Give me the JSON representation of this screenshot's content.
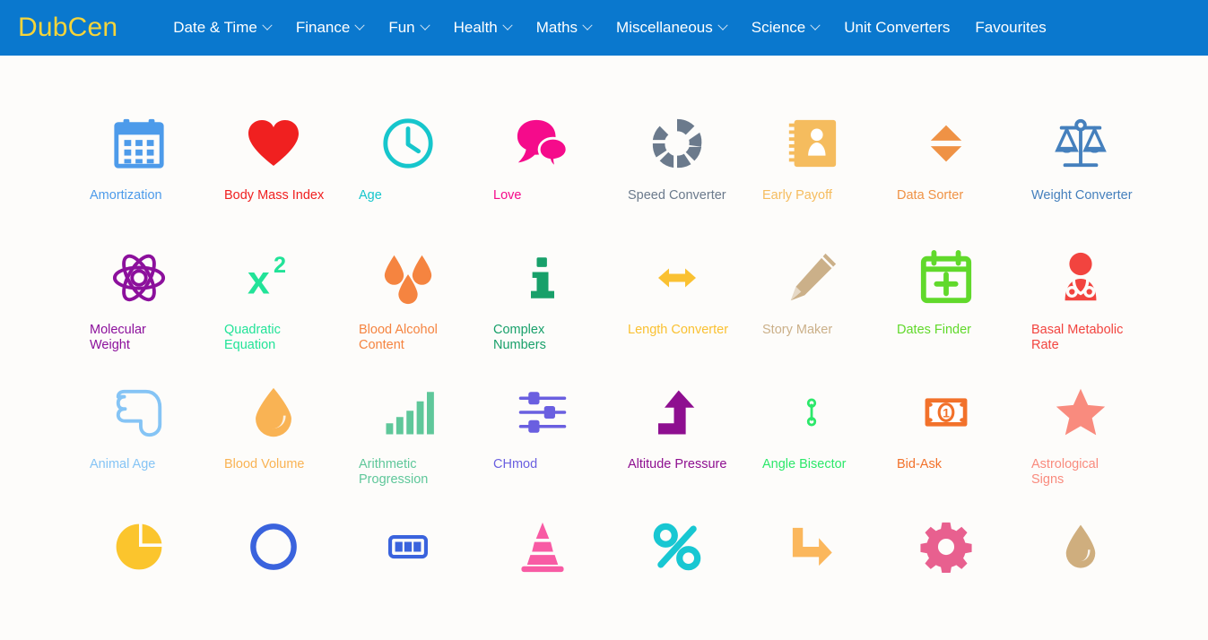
{
  "header": {
    "brand": "DubCen",
    "brand_color": "#f5d43a",
    "bar_color": "#0a78ce",
    "nav": [
      {
        "label": "Date & Time",
        "has_caret": true,
        "icon": "chevron-down-icon"
      },
      {
        "label": "Finance",
        "has_caret": true,
        "icon": "chevron-down-icon"
      },
      {
        "label": "Fun",
        "has_caret": true,
        "icon": "chevron-down-icon"
      },
      {
        "label": "Health",
        "has_caret": true,
        "icon": "chevron-down-icon"
      },
      {
        "label": "Maths",
        "has_caret": true,
        "icon": "chevron-down-icon"
      },
      {
        "label": "Miscellaneous",
        "has_caret": true,
        "icon": "chevron-down-icon"
      },
      {
        "label": "Science",
        "has_caret": true,
        "icon": "chevron-down-icon"
      },
      {
        "label": "Unit Converters",
        "has_caret": false,
        "icon": ""
      },
      {
        "label": "Favourites",
        "has_caret": false,
        "icon": ""
      }
    ]
  },
  "background_color": "#fdfcfa",
  "tiles": [
    {
      "label": "Amortization",
      "icon": "calendar-icon",
      "color": "#4d9bea"
    },
    {
      "label": "Body Mass Index",
      "icon": "heart-icon",
      "color": "#f02020"
    },
    {
      "label": "Age",
      "icon": "clock-icon",
      "color": "#16c6cc"
    },
    {
      "label": "Love",
      "icon": "speech-bubbles-icon",
      "color": "#f50b8b"
    },
    {
      "label": "Speed Converter",
      "icon": "speedometer-ring-icon",
      "color": "#6b7a8c"
    },
    {
      "label": "Early Payoff",
      "icon": "notebook-icon",
      "color": "#f5bc5e"
    },
    {
      "label": "Data Sorter",
      "icon": "sort-arrows-icon",
      "color": "#ef9245"
    },
    {
      "label": "Weight Converter",
      "icon": "balance-scale-icon",
      "color": "#4580bd"
    },
    {
      "label": "Molecular\nWeight",
      "icon": "atom-icon",
      "color": "#8c109c"
    },
    {
      "label": "Quadratic\nEquation",
      "icon": "x-squared-icon",
      "color": "#22e398"
    },
    {
      "label": "Blood Alcohol\nContent",
      "icon": "blood-drops-icon",
      "color": "#f58440"
    },
    {
      "label": "Complex\nNumbers",
      "icon": "info-i-icon",
      "color": "#18a06a"
    },
    {
      "label": "Length Converter",
      "icon": "double-arrow-icon",
      "color": "#fac132"
    },
    {
      "label": "Story Maker",
      "icon": "pencil-icon",
      "color": "#cbb089"
    },
    {
      "label": "Dates Finder",
      "icon": "calendar-plus-icon",
      "color": "#61d92b"
    },
    {
      "label": "Basal Metabolic\nRate",
      "icon": "doctor-icon",
      "color": "#f2443f"
    },
    {
      "label": "Animal Age",
      "icon": "paw-hand-icon",
      "color": "#85c4f5"
    },
    {
      "label": "Blood Volume",
      "icon": "water-drop-icon",
      "color": "#f9b354"
    },
    {
      "label": "Arithmetic\nProgression",
      "icon": "bar-chart-icon",
      "color": "#5fc79a"
    },
    {
      "label": "CHmod",
      "icon": "sliders-icon",
      "color": "#6a5fe0"
    },
    {
      "label": "Altitude Pressure",
      "icon": "up-arrow-bend-icon",
      "color": "#8e0f90"
    },
    {
      "label": "Angle Bisector",
      "icon": "line-segment-icon",
      "color": "#2ce86a"
    },
    {
      "label": "Bid-Ask",
      "icon": "banknote-icon",
      "color": "#f2712a"
    },
    {
      "label": "Astrological\nSigns",
      "icon": "star-icon",
      "color": "#f98b7e"
    },
    {
      "label": "",
      "icon": "pie-chart-icon",
      "color": "#fbc52d"
    },
    {
      "label": "",
      "icon": "circle-outline-icon",
      "color": "#3a63dd"
    },
    {
      "label": "",
      "icon": "battery-icon",
      "color": "#3a63dd"
    },
    {
      "label": "",
      "icon": "traffic-cone-icon",
      "color": "#f85ba4"
    },
    {
      "label": "",
      "icon": "percent-icon",
      "color": "#18c7d2"
    },
    {
      "label": "",
      "icon": "arrow-turn-right-icon",
      "color": "#fbb75c"
    },
    {
      "label": "",
      "icon": "gear-icon",
      "color": "#e8608f"
    },
    {
      "label": "",
      "icon": "oil-drop-icon",
      "color": "#cfae7e"
    }
  ]
}
